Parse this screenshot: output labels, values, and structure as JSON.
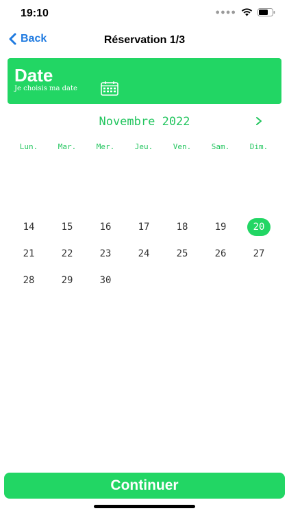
{
  "status_bar": {
    "time": "19:10"
  },
  "nav": {
    "back_label": "Back",
    "title": "Réservation 1/3"
  },
  "banner": {
    "title": "Date",
    "subtitle": "Je choisis ma date",
    "icon": "calendar-icon"
  },
  "calendar": {
    "month_label": "Novembre 2022",
    "weekdays": [
      "Lun.",
      "Mar.",
      "Mer.",
      "Jeu.",
      "Ven.",
      "Sam.",
      "Dim."
    ],
    "weeks": [
      [
        "14",
        "15",
        "16",
        "17",
        "18",
        "19",
        "20"
      ],
      [
        "21",
        "22",
        "23",
        "24",
        "25",
        "26",
        "27"
      ],
      [
        "28",
        "29",
        "30",
        "",
        "",
        "",
        ""
      ]
    ],
    "selected_day": "20"
  },
  "actions": {
    "continue_label": "Continuer"
  },
  "colors": {
    "accent": "#22d664",
    "link": "#1f7ae0"
  }
}
